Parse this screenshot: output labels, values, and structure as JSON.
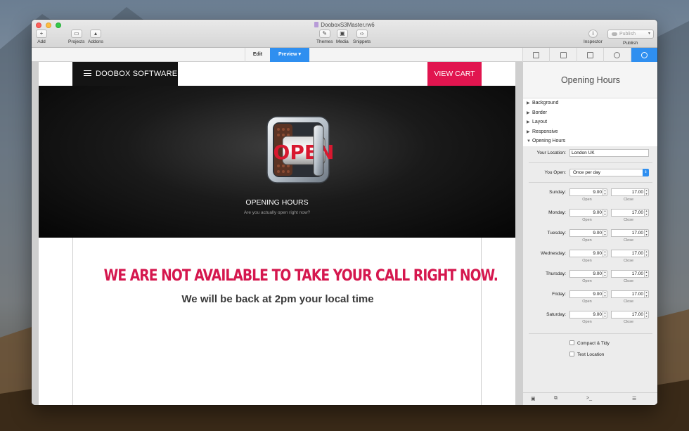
{
  "window": {
    "doc_title": "DooboxS3Master.rw6"
  },
  "toolbar": {
    "add": "Add",
    "projects": "Projects",
    "addons": "Addons",
    "themes": "Themes",
    "media": "Media",
    "snippets": "Snippets",
    "inspector": "Inspector",
    "publish_button": "Publish",
    "publish_label": "Publish"
  },
  "modebar": {
    "edit": "Edit",
    "preview": "Preview ▾"
  },
  "page": {
    "brand": "DOOBOX SOFTWARE",
    "cart": "VIEW CART",
    "hero_title": "OPENING HOURS",
    "hero_sub": "Are you actually open right now?",
    "safe_text": "OPEN",
    "headline": "WE ARE NOT AVAILABLE TO TAKE YOUR CALL RIGHT NOW.",
    "subline": "We will be back at 2pm your local time"
  },
  "inspector": {
    "title": "Opening Hours",
    "sections": [
      {
        "label": "Background",
        "open": false
      },
      {
        "label": "Border",
        "open": false
      },
      {
        "label": "Layout",
        "open": false
      },
      {
        "label": "Responsive",
        "open": false
      },
      {
        "label": "Opening Hours",
        "open": true
      }
    ],
    "location_label": "Your Location:",
    "location_value": "London UK",
    "open_label": "You Open:",
    "open_value": "Once per day",
    "open_sub": "Open",
    "close_sub": "Close",
    "days": [
      {
        "name": "Sunday:",
        "open": "9.00",
        "close": "17.00"
      },
      {
        "name": "Monday:",
        "open": "9.00",
        "close": "17.00"
      },
      {
        "name": "Tuesday:",
        "open": "9.00",
        "close": "17.00"
      },
      {
        "name": "Wednesday:",
        "open": "9.00",
        "close": "17.00"
      },
      {
        "name": "Thursday:",
        "open": "9.00",
        "close": "17.00"
      },
      {
        "name": "Friday:",
        "open": "9.00",
        "close": "17.00"
      },
      {
        "name": "Saturday:",
        "open": "9.00",
        "close": "17.00"
      }
    ],
    "compact_tidy": "Compact & Tidy",
    "test_location": "Test Location",
    "foot_terminal": ">_"
  },
  "colors": {
    "accent": "#2f8ff0",
    "brand_red": "#e1154f",
    "headline": "#d5174e"
  }
}
